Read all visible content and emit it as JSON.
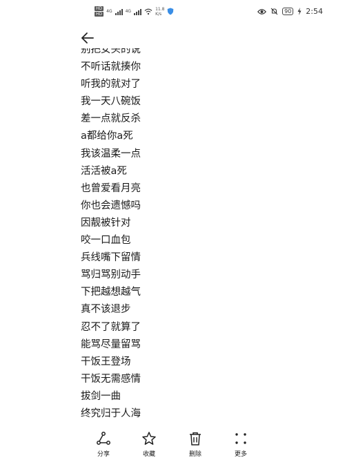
{
  "status_bar": {
    "sim1": "HD",
    "sim2": "HD",
    "net1": "4G",
    "net2": "4G",
    "speed_value": "11.8",
    "speed_unit": "K/s",
    "battery": "90",
    "time": "2:54"
  },
  "lines": [
    "别把女头的说",
    "不听话就揍你",
    "听我的就对了",
    "我一天八碗饭",
    "差一点就反杀",
    "a都给你a死",
    "我该温柔一点",
    "活活被a死",
    "也曾爱看月亮",
    "你也会遗憾吗",
    "因靓被针对",
    "咬一口血包",
    "兵线嘴下留情",
    "骂归骂别动手",
    "下把越想越气",
    "真不该退步",
    "忍不了就算了",
    "能骂尽量留骂",
    "干饭王登场",
    "干饭无需感情",
    "拔剑一曲",
    "终究归于人海"
  ],
  "toolbar": {
    "share_label": "分享",
    "favorite_label": "收藏",
    "delete_label": "删除",
    "more_label": "更多"
  },
  "icons": {
    "back": "arrow-left-icon",
    "share": "share-icon",
    "favorite": "star-icon",
    "delete": "trash-icon",
    "more": "more-dots-icon"
  }
}
